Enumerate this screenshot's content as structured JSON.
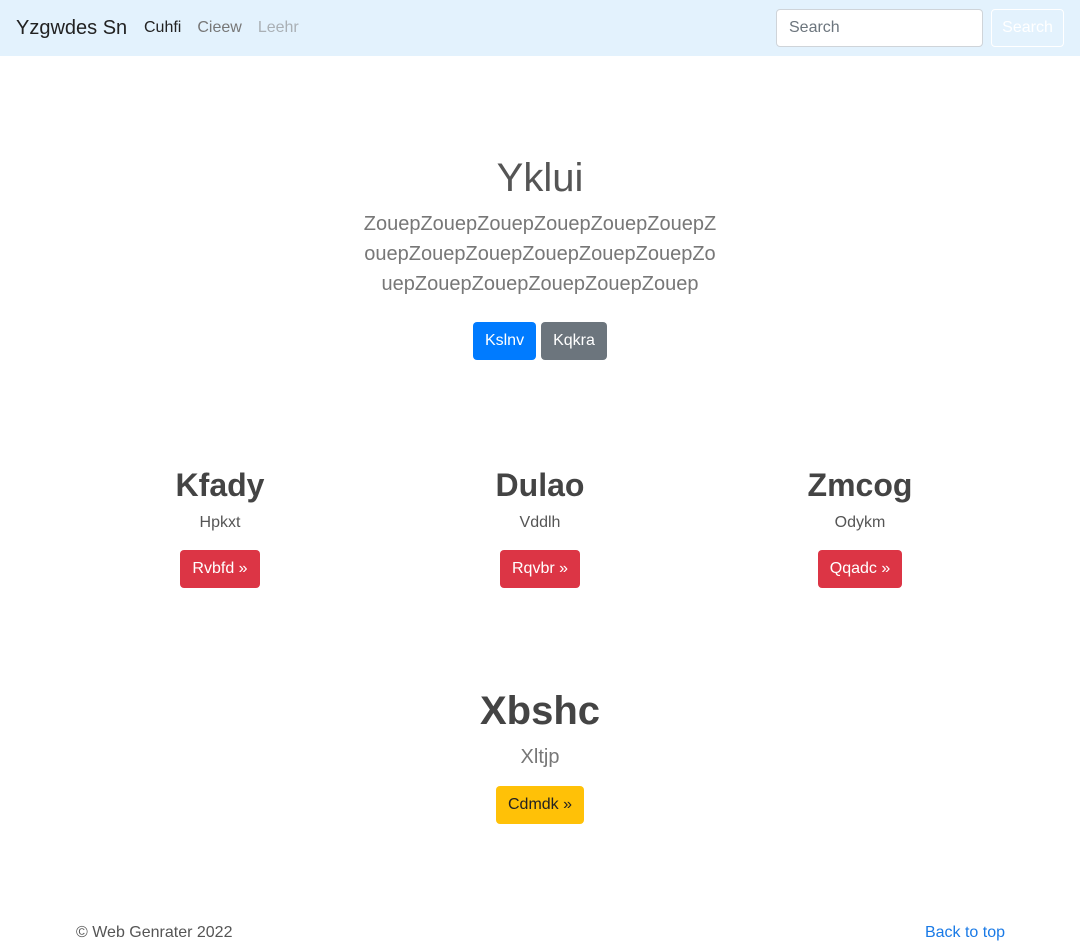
{
  "navbar": {
    "brand": "Yzgwdes Sn",
    "links": [
      {
        "label": "Cuhfi"
      },
      {
        "label": "Cieew"
      },
      {
        "label": "Leehr"
      }
    ],
    "search_placeholder": "Search",
    "search_button": "Search"
  },
  "hero": {
    "title": "Yklui",
    "lead": "ZouepZouepZouepZouepZouepZouepZouepZouepZouepZouepZouepZouepZouepZouepZouepZouepZouepZouep",
    "primary_button": "Kslnv",
    "secondary_button": "Kqkra"
  },
  "features": [
    {
      "title": "Kfady",
      "text": "Hpkxt",
      "button": "Rvbfd »"
    },
    {
      "title": "Dulao",
      "text": "Vddlh",
      "button": "Rqvbr »"
    },
    {
      "title": "Zmcog",
      "text": "Odykm",
      "button": "Qqadc »"
    }
  ],
  "promo": {
    "title": "Xbshc",
    "lead": "Xltjp",
    "button": "Cdmdk »"
  },
  "footer": {
    "copyright": "© Web Genrater 2022",
    "back_to_top": "Back to top"
  },
  "colors": {
    "navbar_bg": "#e3f2fd",
    "primary": "#007bff",
    "secondary": "#6c757d",
    "danger": "#dc3545",
    "warning": "#ffc107",
    "link": "#1a7ae6"
  }
}
